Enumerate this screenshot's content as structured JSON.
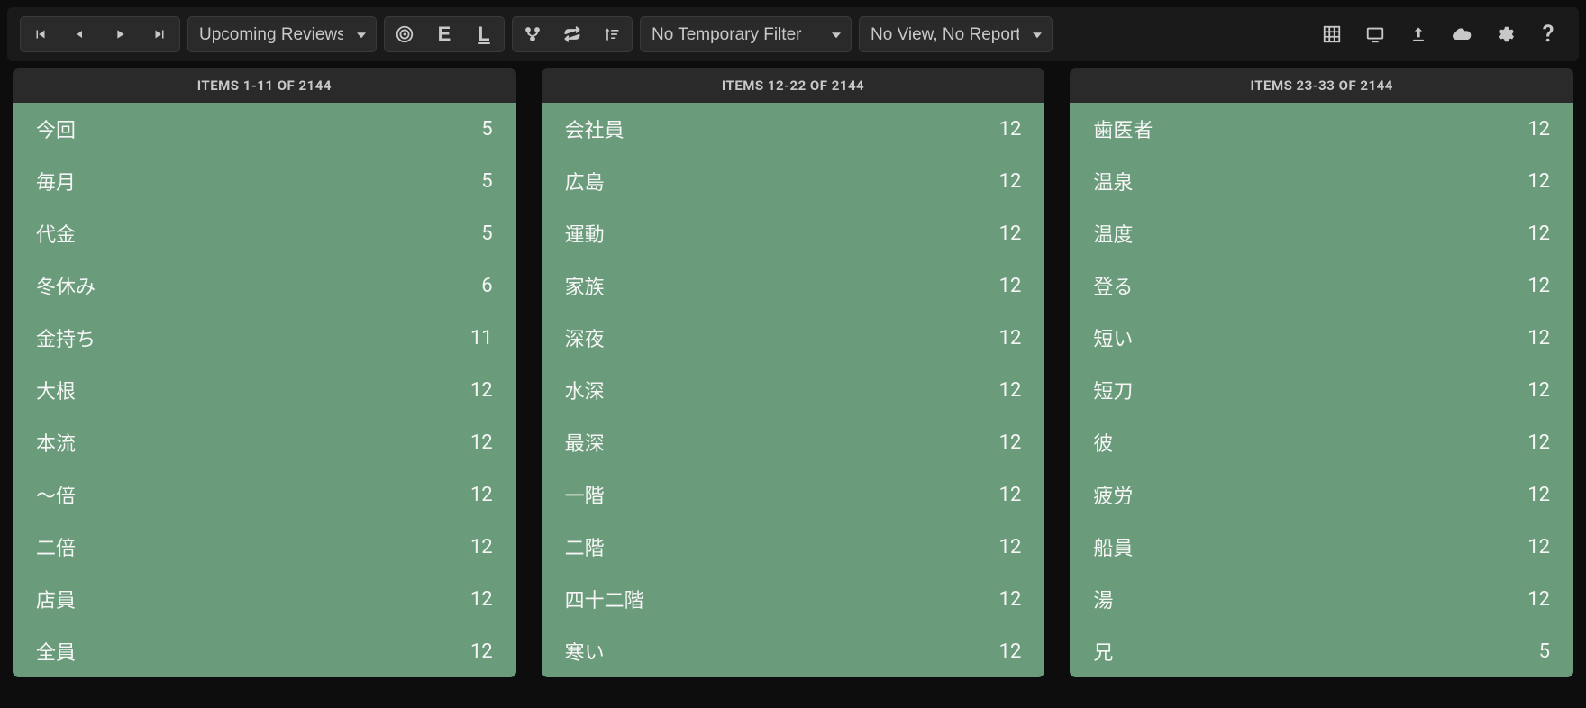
{
  "toolbar": {
    "view_select": "Upcoming Reviews",
    "filter_select": "No Temporary Filter",
    "report_select": "No View, No Report",
    "letter_e": "E",
    "letter_l": "L"
  },
  "total_items": 2144,
  "columns": [
    {
      "header": "ITEMS 1-11 OF 2144",
      "rows": [
        {
          "word": "今回",
          "num": "5"
        },
        {
          "word": "毎月",
          "num": "5"
        },
        {
          "word": "代金",
          "num": "5"
        },
        {
          "word": "冬休み",
          "num": "6"
        },
        {
          "word": "金持ち",
          "num": "11"
        },
        {
          "word": "大根",
          "num": "12"
        },
        {
          "word": "本流",
          "num": "12"
        },
        {
          "word": "〜倍",
          "num": "12"
        },
        {
          "word": "二倍",
          "num": "12"
        },
        {
          "word": "店員",
          "num": "12"
        },
        {
          "word": "全員",
          "num": "12"
        }
      ]
    },
    {
      "header": "ITEMS 12-22 OF 2144",
      "rows": [
        {
          "word": "会社員",
          "num": "12"
        },
        {
          "word": "広島",
          "num": "12"
        },
        {
          "word": "運動",
          "num": "12"
        },
        {
          "word": "家族",
          "num": "12"
        },
        {
          "word": "深夜",
          "num": "12"
        },
        {
          "word": "水深",
          "num": "12"
        },
        {
          "word": "最深",
          "num": "12"
        },
        {
          "word": "一階",
          "num": "12"
        },
        {
          "word": "二階",
          "num": "12"
        },
        {
          "word": "四十二階",
          "num": "12"
        },
        {
          "word": "寒い",
          "num": "12"
        }
      ]
    },
    {
      "header": "ITEMS 23-33 OF 2144",
      "rows": [
        {
          "word": "歯医者",
          "num": "12"
        },
        {
          "word": "温泉",
          "num": "12"
        },
        {
          "word": "温度",
          "num": "12"
        },
        {
          "word": "登る",
          "num": "12"
        },
        {
          "word": "短い",
          "num": "12"
        },
        {
          "word": "短刀",
          "num": "12"
        },
        {
          "word": "彼",
          "num": "12"
        },
        {
          "word": "疲労",
          "num": "12"
        },
        {
          "word": "船員",
          "num": "12"
        },
        {
          "word": "湯",
          "num": "12"
        },
        {
          "word": "兄",
          "num": "5"
        }
      ]
    }
  ]
}
